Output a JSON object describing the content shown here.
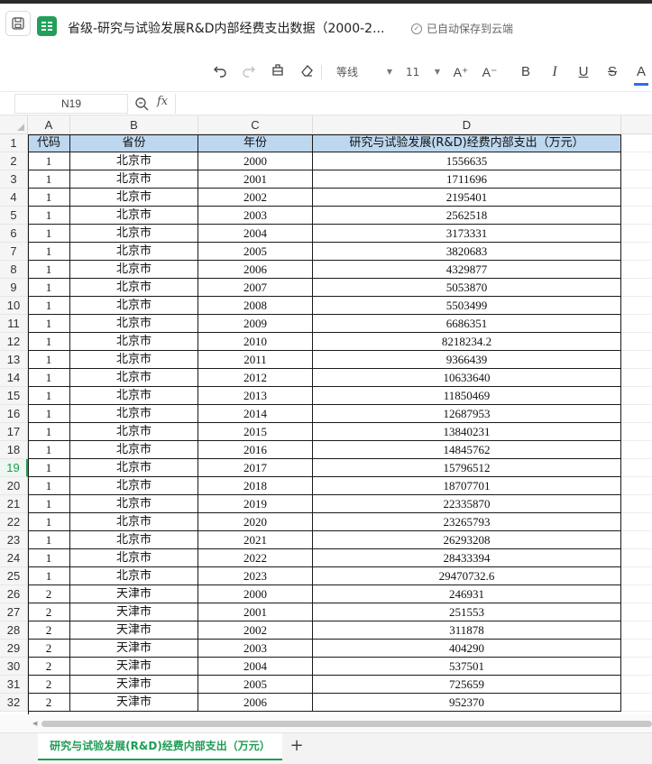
{
  "document": {
    "title": "省级-研究与试验发展R&D内部经费支出数据（2000-2...",
    "autosave_status": "已自动保存到云端"
  },
  "toolbar": {
    "font_name": "等线",
    "font_size": "11",
    "increase_font": "A⁺",
    "decrease_font": "A⁻",
    "bold": "B",
    "italic": "I",
    "underline": "U",
    "strikethrough": "S",
    "font_color": "A",
    "accent_color": "#2d6fe8"
  },
  "formula_bar": {
    "cell_reference": "N19",
    "fx_label": "fx",
    "value": ""
  },
  "grid": {
    "selected_row": 19,
    "columns": [
      "A",
      "B",
      "C",
      "D"
    ],
    "header_row": [
      "代码",
      "省份",
      "年份",
      "研究与试验发展(R&D)经费内部支出（万元）"
    ],
    "header_fill": "#bdd7ee",
    "rows": [
      [
        "1",
        "北京市",
        "2000",
        "1556635"
      ],
      [
        "1",
        "北京市",
        "2001",
        "1711696"
      ],
      [
        "1",
        "北京市",
        "2002",
        "2195401"
      ],
      [
        "1",
        "北京市",
        "2003",
        "2562518"
      ],
      [
        "1",
        "北京市",
        "2004",
        "3173331"
      ],
      [
        "1",
        "北京市",
        "2005",
        "3820683"
      ],
      [
        "1",
        "北京市",
        "2006",
        "4329877"
      ],
      [
        "1",
        "北京市",
        "2007",
        "5053870"
      ],
      [
        "1",
        "北京市",
        "2008",
        "5503499"
      ],
      [
        "1",
        "北京市",
        "2009",
        "6686351"
      ],
      [
        "1",
        "北京市",
        "2010",
        "8218234.2"
      ],
      [
        "1",
        "北京市",
        "2011",
        "9366439"
      ],
      [
        "1",
        "北京市",
        "2012",
        "10633640"
      ],
      [
        "1",
        "北京市",
        "2013",
        "11850469"
      ],
      [
        "1",
        "北京市",
        "2014",
        "12687953"
      ],
      [
        "1",
        "北京市",
        "2015",
        "13840231"
      ],
      [
        "1",
        "北京市",
        "2016",
        "14845762"
      ],
      [
        "1",
        "北京市",
        "2017",
        "15796512"
      ],
      [
        "1",
        "北京市",
        "2018",
        "18707701"
      ],
      [
        "1",
        "北京市",
        "2019",
        "22335870"
      ],
      [
        "1",
        "北京市",
        "2020",
        "23265793"
      ],
      [
        "1",
        "北京市",
        "2021",
        "26293208"
      ],
      [
        "1",
        "北京市",
        "2022",
        "28433394"
      ],
      [
        "1",
        "北京市",
        "2023",
        "29470732.6"
      ],
      [
        "2",
        "天津市",
        "2000",
        "246931"
      ],
      [
        "2",
        "天津市",
        "2001",
        "251553"
      ],
      [
        "2",
        "天津市",
        "2002",
        "311878"
      ],
      [
        "2",
        "天津市",
        "2003",
        "404290"
      ],
      [
        "2",
        "天津市",
        "2004",
        "537501"
      ],
      [
        "2",
        "天津市",
        "2005",
        "725659"
      ],
      [
        "2",
        "天津市",
        "2006",
        "952370"
      ]
    ]
  },
  "sheets": {
    "active_tab": "研究与试验发展(R&D)经费内部支出（万元）",
    "add_label": "+"
  },
  "colors": {
    "brand_green": "#1f9d55"
  }
}
